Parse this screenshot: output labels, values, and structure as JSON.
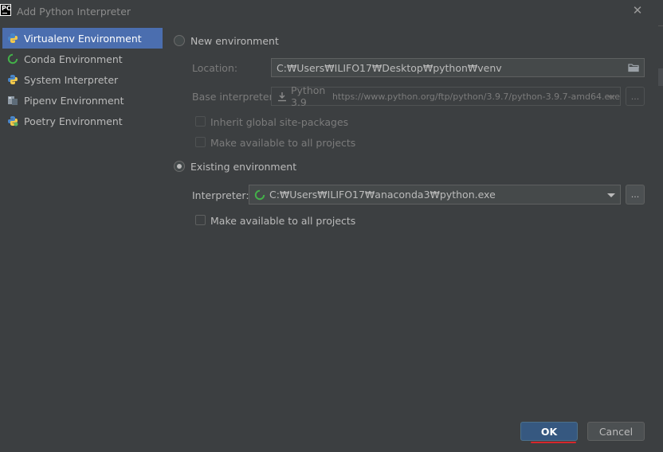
{
  "window": {
    "title": "Add Python Interpreter",
    "app_icon_text": "PC"
  },
  "sidebar": {
    "items": [
      {
        "label": "Virtualenv Environment",
        "icon": "python-icon",
        "selected": true
      },
      {
        "label": "Conda Environment",
        "icon": "conda-icon",
        "selected": false
      },
      {
        "label": "System Interpreter",
        "icon": "python-icon",
        "selected": false
      },
      {
        "label": "Pipenv Environment",
        "icon": "pipenv-icon",
        "selected": false
      },
      {
        "label": "Poetry Environment",
        "icon": "poetry-icon",
        "selected": false
      }
    ]
  },
  "new_env": {
    "radio_label": "New environment",
    "location_label": "Location:",
    "location_value": "C:₩Users₩ILIFO17₩Desktop₩python₩venv",
    "base_label": "Base interpreter:",
    "base_value": "Python 3.9",
    "base_url": "https://www.python.org/ftp/python/3.9.7/python-3.9.7-amd64.exe",
    "inherit_label": "Inherit global site-packages",
    "make_available_label": "Make available to all projects"
  },
  "existing_env": {
    "radio_label": "Existing environment",
    "interpreter_label": "Interpreter:",
    "interpreter_value": "C:₩Users₩ILIFO17₩anaconda3₩python.exe",
    "make_available_label": "Make available to all projects"
  },
  "buttons": {
    "ok": "OK",
    "cancel": "Cancel",
    "browse": "..."
  },
  "colors": {
    "background": "#3c3f41",
    "selection": "#4b6eaf",
    "ok_button": "#365880",
    "annotation_underline": "#d7262b"
  }
}
